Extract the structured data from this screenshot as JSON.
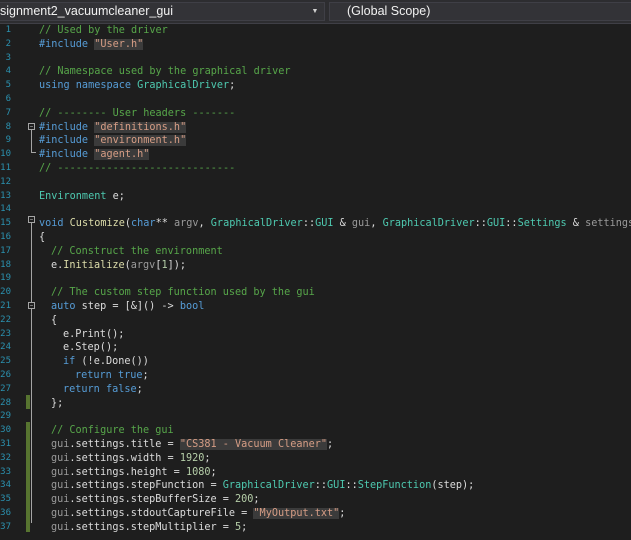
{
  "nav": {
    "file_combo": "signment2_vacuumcleaner_gui",
    "scope_combo": "(Global Scope)"
  },
  "line_numbers": [
    "1",
    "2",
    "3",
    "4",
    "5",
    "6",
    "7",
    "8",
    "9",
    "10",
    "11",
    "12",
    "13",
    "14",
    "15",
    "16",
    "17",
    "18",
    "19",
    "20",
    "21",
    "22",
    "23",
    "24",
    "25",
    "26",
    "27",
    "28",
    "29",
    "30",
    "31",
    "32",
    "33",
    "34",
    "35",
    "36",
    "37"
  ],
  "code": {
    "l1": "// Used by the driver",
    "l2_dir": "#include ",
    "l2_str": "\"User.h\"",
    "l4": "// Namespace used by the graphical driver",
    "l5_kw": "using namespace ",
    "l5_ns": "GraphicalDriver",
    "l5_end": ";",
    "l7": "// -------- User headers -------",
    "l8_dir": "#include ",
    "l8_str": "\"definitions.h\"",
    "l9_dir": "#include ",
    "l9_str": "\"environment.h\"",
    "l10_dir": "#include ",
    "l10_str": "\"agent.h\"",
    "l11": "// -----------------------------",
    "l13_type": "Environment",
    "l13_rest": " e;",
    "l15_kw": "void ",
    "l15_fn": "Customize",
    "l15_p1": "(",
    "l15_char": "char",
    "l15_p2": "** ",
    "l15_argv": "argv",
    "l15_p3": ", ",
    "l15_gd1": "GraphicalDriver",
    "l15_sep1": "::",
    "l15_gui1": "GUI",
    "l15_amp1": " & ",
    "l15_gui": "gui",
    "l15_p4": ", ",
    "l15_gd2": "GraphicalDriver",
    "l15_sep2": "::",
    "l15_gui2": "GUI",
    "l15_sep3": "::",
    "l15_settings": "Settings",
    "l15_amp2": " & ",
    "l15_set": "settings",
    "l15_p5": ")",
    "l16": "{",
    "l17": "// Construct the environment",
    "l18_e": "e",
    "l18_dot": ".",
    "l18_fn": "Initialize",
    "l18_p1": "(",
    "l18_argv": "argv",
    "l18_idx1": "[",
    "l18_num": "1",
    "l18_idx2": "]",
    "l18_end": ");",
    "l20": "// The custom step function used by the gui",
    "l21_kw": "auto ",
    "l21_var": "step",
    "l21_mid": " = [&]() -> ",
    "l21_bool": "bool",
    "l22": "{",
    "l23_e": "e",
    "l23_rest": ".Print();",
    "l24_e": "e",
    "l24_rest": ".Step();",
    "l25_kw": "if ",
    "l25_p": "(!",
    "l25_e": "e",
    "l25_rest": ".Done())",
    "l26_kw": "return ",
    "l26_val": "true",
    "l26_end": ";",
    "l27_kw": "return ",
    "l27_val": "false",
    "l27_end": ";",
    "l28": "};",
    "l30": "// Configure the gui",
    "l31_obj": "gui",
    "l31_mid": ".settings.title = ",
    "l31_str": "\"CS381 - Vacuum Cleaner\"",
    "l31_end": ";",
    "l32_obj": "gui",
    "l32_mid": ".settings.width = ",
    "l32_num": "1920",
    "l32_end": ";",
    "l33_obj": "gui",
    "l33_mid": ".settings.height = ",
    "l33_num": "1080",
    "l33_end": ";",
    "l34_obj": "gui",
    "l34_mid": ".settings.stepFunction = ",
    "l34_ns": "GraphicalDriver",
    "l34_sep1": "::",
    "l34_gui": "GUI",
    "l34_sep2": "::",
    "l34_fn": "StepFunction",
    "l34_p1": "(",
    "l34_step": "step",
    "l34_end": ");",
    "l35_obj": "gui",
    "l35_mid": ".settings.stepBufferSize = ",
    "l35_num": "200",
    "l35_end": ";",
    "l36_obj": "gui",
    "l36_mid": ".settings.stdoutCaptureFile = ",
    "l36_str": "\"MyOutput.txt\"",
    "l36_end": ";",
    "l37_obj": "gui",
    "l37_mid": ".settings.stepMultiplier = ",
    "l37_num": "5",
    "l37_end": ";"
  },
  "colors": {
    "background": "#1e1e1e",
    "comment": "#57a64a",
    "keyword": "#569cd6",
    "string": "#d69d85",
    "type": "#4ec9b0",
    "line_number": "#2b91af",
    "change_bar": "#577430"
  }
}
